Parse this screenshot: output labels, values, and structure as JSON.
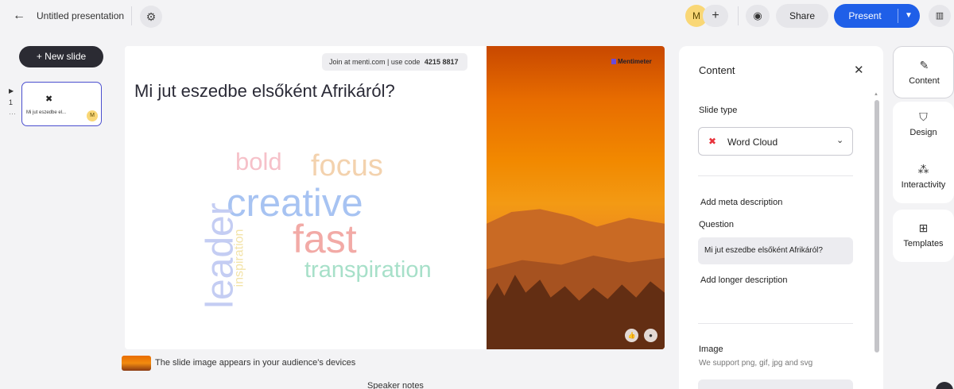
{
  "topbar": {
    "back_icon": "arrow-left-icon",
    "title": "Untitled presentation",
    "settings_icon": "gear-icon",
    "avatar_initial": "M",
    "add_collaborator": "+",
    "preview_icon": "eye-icon",
    "share_label": "Share",
    "present_label": "Present",
    "present_menu_icon": "chevron-down-icon",
    "overflow_icon": "menti-icon"
  },
  "slides_panel": {
    "new_slide_label": "+ New slide",
    "slides": [
      {
        "number": "1",
        "type_icon": "word-cloud-icon",
        "label": "Mi jut eszedbe el...",
        "avatar": "M"
      }
    ]
  },
  "slide": {
    "join_text": "Join at menti.com | use code",
    "join_code": "4215 8817",
    "question": "Mi jut eszedbe elsőként Afrikáról?",
    "brand": "Mentimeter",
    "word_cloud": [
      "bold",
      "focus",
      "creative",
      "fast",
      "transpiration",
      "leader",
      "inspiration"
    ],
    "reaction_icons": [
      "thumbs-up-icon",
      "person-icon"
    ]
  },
  "image_note": "The slide image appears in your audience's devices",
  "speaker_notes_label": "Speaker notes",
  "content_panel": {
    "title": "Content",
    "close_icon": "close-icon",
    "slide_type_label": "Slide type",
    "slide_type_value": "Word Cloud",
    "add_meta_description": "Add meta description",
    "question_label": "Question",
    "question_value": "Mi jut eszedbe elsőként Afrikáról?",
    "add_longer_description": "Add longer description",
    "image_label": "Image",
    "image_support": "We support png, gif, jpg and svg"
  },
  "right_toolbar": {
    "items": [
      {
        "label": "Content",
        "icon": "pencil-icon",
        "active": true
      },
      {
        "label": "Design",
        "icon": "paint-brush-icon",
        "active": false
      },
      {
        "label": "Interactivity",
        "icon": "interactivity-icon",
        "active": false
      },
      {
        "label": "Templates",
        "icon": "templates-icon",
        "active": false
      }
    ]
  },
  "colors": {
    "accent": "#1f5fe8",
    "selected_thumb_border": "#4b4fcf",
    "word_cloud_icon": "#e8333c",
    "avatar": "#f9d776"
  }
}
